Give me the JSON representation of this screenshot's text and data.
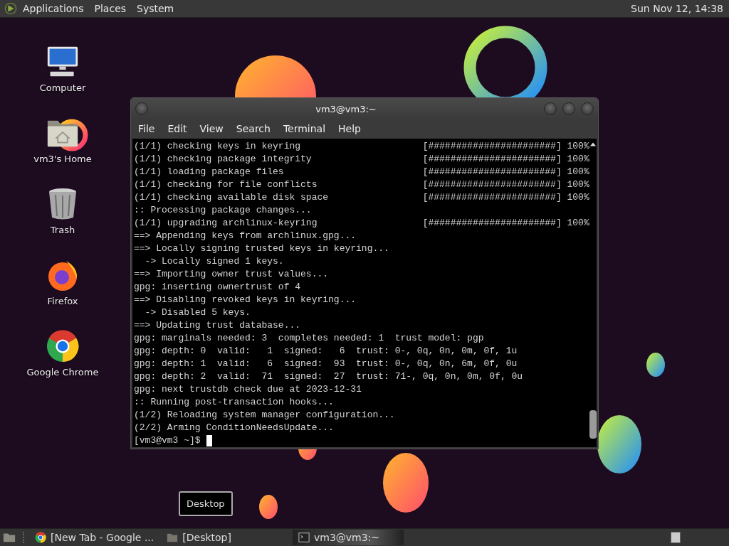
{
  "top_panel": {
    "menus": [
      "Applications",
      "Places",
      "System"
    ],
    "clock": "Sun Nov 12, 14:38"
  },
  "desktop_icons": [
    {
      "label": "Computer",
      "kind": "computer"
    },
    {
      "label": "vm3's Home",
      "kind": "home"
    },
    {
      "label": "Trash",
      "kind": "trash"
    },
    {
      "label": "Firefox",
      "kind": "firefox"
    },
    {
      "label": "Google Chrome",
      "kind": "chrome"
    }
  ],
  "terminal": {
    "title": "vm3@vm3:~",
    "menus": [
      "File",
      "Edit",
      "View",
      "Search",
      "Terminal",
      "Help"
    ],
    "lines": [
      "(1/1) checking keys in keyring                      [#######################] 100%",
      "(1/1) checking package integrity                    [#######################] 100%",
      "(1/1) loading package files                         [#######################] 100%",
      "(1/1) checking for file conflicts                   [#######################] 100%",
      "(1/1) checking available disk space                 [#######################] 100%",
      ":: Processing package changes...",
      "(1/1) upgrading archlinux-keyring                   [#######################] 100%",
      "==> Appending keys from archlinux.gpg...",
      "==> Locally signing trusted keys in keyring...",
      "  -> Locally signed 1 keys.",
      "==> Importing owner trust values...",
      "gpg: inserting ownertrust of 4",
      "==> Disabling revoked keys in keyring...",
      "  -> Disabled 5 keys.",
      "==> Updating trust database...",
      "gpg: marginals needed: 3  completes needed: 1  trust model: pgp",
      "gpg: depth: 0  valid:   1  signed:   6  trust: 0-, 0q, 0n, 0m, 0f, 1u",
      "gpg: depth: 1  valid:   6  signed:  93  trust: 0-, 0q, 0n, 6m, 0f, 0u",
      "gpg: depth: 2  valid:  71  signed:  27  trust: 71-, 0q, 0n, 0m, 0f, 0u",
      "gpg: next trustdb check due at 2023-12-31",
      ":: Running post-transaction hooks...",
      "(1/2) Reloading system manager configuration...",
      "(2/2) Arming ConditionNeedsUpdate..."
    ],
    "prompt": "[vm3@vm3 ~]$"
  },
  "tooltip": "Desktop",
  "taskbar": {
    "items": [
      {
        "label": "[New Tab - Google ...",
        "kind": "browser",
        "selected": false
      },
      {
        "label": "[Desktop]",
        "kind": "folder",
        "selected": false
      },
      {
        "label": "vm3@vm3:~",
        "kind": "terminal",
        "selected": true
      }
    ]
  }
}
